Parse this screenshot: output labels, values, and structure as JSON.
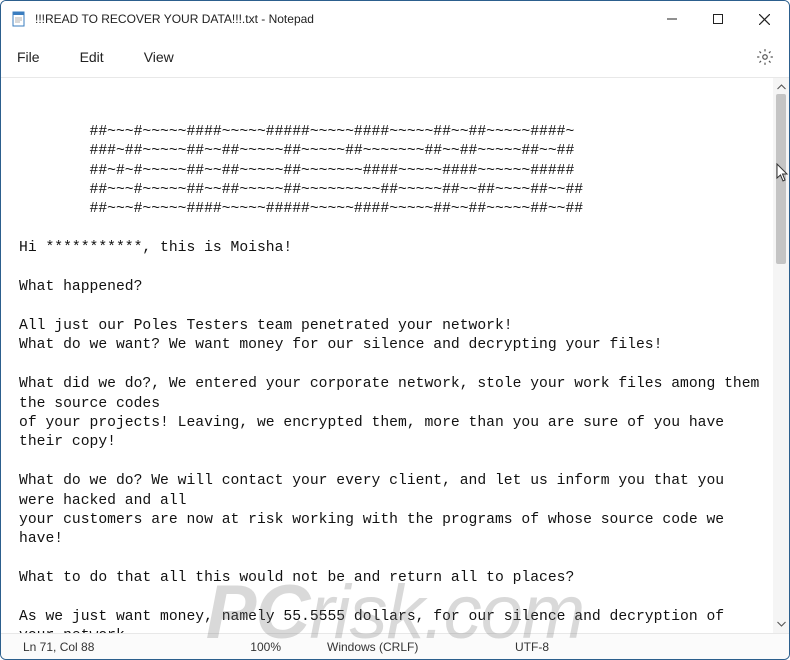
{
  "titlebar": {
    "title": "!!!READ TO RECOVER YOUR DATA!!!.txt - Notepad"
  },
  "menu": {
    "file": "File",
    "edit": "Edit",
    "view": "View"
  },
  "content": {
    "text": "\n\n        ##~~~#~~~~~####~~~~~#####~~~~~####~~~~~##~~##~~~~~####~\n        ###~##~~~~~##~~##~~~~~##~~~~~##~~~~~~~##~~##~~~~~##~~##\n        ##~#~#~~~~~##~~##~~~~~##~~~~~~~####~~~~~####~~~~~~#####\n        ##~~~#~~~~~##~~##~~~~~##~~~~~~~~~##~~~~~##~~##~~~~##~~##\n        ##~~~#~~~~~####~~~~~#####~~~~~####~~~~~##~~##~~~~~##~~##\n\nHi ***********, this is Moisha!\n\nWhat happened?\n\nAll just our Poles Testers team penetrated your network!\nWhat do we want? We want money for our silence and decrypting your files!\n\nWhat did we do?, We entered your corporate network, stole your work files among them the source codes\nof your projects! Leaving, we encrypted them, more than you are sure of you have their copy!\n\nWhat do we do? We will contact your every client, and let us inform you that you were hacked and all\nyour customers are now at risk working with the programs of whose source code we have!\n\nWhat to do that all this would not be and return all to places?\n\nAs we just want money, namely 55.5555 dollars, for our silence and decryption of your network."
  },
  "status": {
    "position": "Ln 71, Col 88",
    "zoom": "100%",
    "line_ending": "Windows (CRLF)",
    "encoding": "UTF-8"
  },
  "watermark": {
    "prefix": "PC",
    "suffix": "risk.com"
  }
}
